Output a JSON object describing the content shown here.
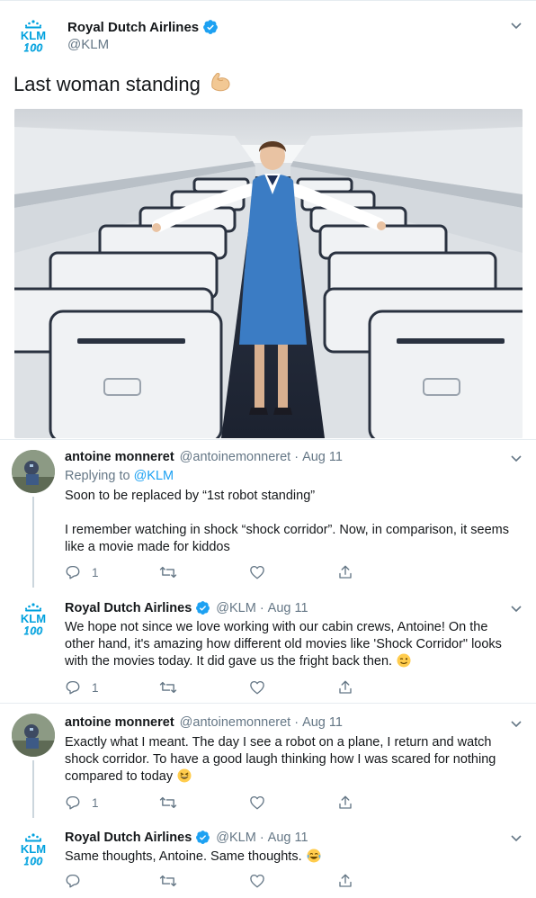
{
  "main_tweet": {
    "display_name": "Royal Dutch Airlines",
    "handle": "@KLM",
    "text": "Last woman standing",
    "emoji": "flexed-biceps",
    "photo": "flight attendant in blue uniform standing in an empty aircraft cabin aisle"
  },
  "replies": [
    {
      "display_name": "antoine monneret",
      "handle": "@antoinemonneret",
      "date": "Aug 11",
      "replying_to_prefix": "Replying to",
      "replying_to": "@KLM",
      "paragraphs": [
        "Soon to be replaced by “1st robot standing”",
        "I remember watching in shock “shock corridor”. Now, in comparison, it seems like a movie made for kiddos"
      ],
      "reply_count": "1"
    },
    {
      "display_name": "Royal Dutch Airlines",
      "handle": "@KLM",
      "date": "Aug 11",
      "paragraphs": [
        "We hope not since we love working with our cabin crews, Antoine! On the other hand, it's amazing how different old movies like 'Shock Corridor\" looks with the movies today. It did gave us the fright back then."
      ],
      "emoji": "winking-face",
      "reply_count": "1"
    },
    {
      "display_name": "antoine monneret",
      "handle": "@antoinemonneret",
      "date": "Aug 11",
      "paragraphs": [
        "Exactly what I meant. The day I see a robot on a plane, I return and watch shock corridor. To have a good laugh thinking how I was scared for nothing compared to today"
      ],
      "emoji": "grinning-squinting-face",
      "reply_count": "1"
    },
    {
      "display_name": "Royal Dutch Airlines",
      "handle": "@KLM",
      "date": "Aug 11",
      "paragraphs": [
        "Same thoughts, Antoine. Same thoughts."
      ],
      "emoji": "face-with-tears-of-joy",
      "reply_count": ""
    }
  ],
  "logo": {
    "brand": "KLM",
    "anniversary": "100"
  },
  "colors": {
    "accent": "#1da1f2",
    "klm_blue": "#00a1de",
    "text": "#14171a",
    "muted": "#657786",
    "divider": "#e6ecf0"
  },
  "icons": [
    "verified-badge-icon",
    "chevron-down-icon",
    "reply-icon",
    "retweet-icon",
    "like-icon",
    "share-icon"
  ]
}
